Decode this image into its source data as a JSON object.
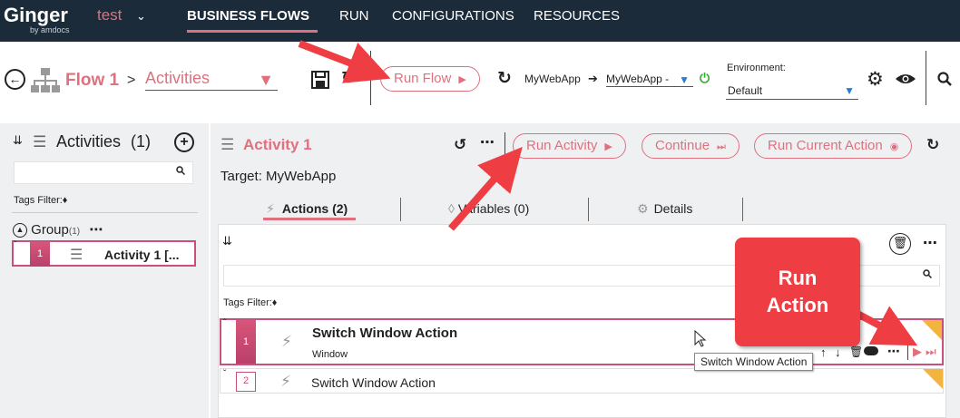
{
  "topbar": {
    "brand": "Ginger",
    "brand_sub": "by amdocs",
    "solution": "test",
    "nav": [
      "BUSINESS FLOWS",
      "RUN",
      "CONFIGURATIONS",
      "RESOURCES"
    ]
  },
  "flow_header": {
    "flow_name": "Flow 1",
    "separator": ">",
    "section_dropdown": "Activities",
    "run_flow_label": "Run Flow",
    "target_app": "MyWebApp",
    "target_agent": "MyWebApp -",
    "environment_label": "Environment:",
    "environment_value": "Default"
  },
  "left_panel": {
    "title": "Activities",
    "count": "(1)",
    "tags_filter_label": "Tags Filter:",
    "group_label": "Group",
    "group_count": "(1)",
    "activity": {
      "index": "1",
      "name": "Activity 1 [..."
    }
  },
  "main_panel": {
    "activity_title": "Activity 1",
    "run_activity_label": "Run Activity",
    "continue_label": "Continue",
    "run_current_action_label": "Run Current Action",
    "target_label": "Target: MyWebApp",
    "tabs": [
      "Actions (2)",
      "Variables (0)",
      "Details"
    ],
    "tags_filter_label": "Tags Filter:",
    "actions": [
      {
        "index": "1",
        "name": "Switch Window Action",
        "sub": "Window"
      },
      {
        "index": "2",
        "name": "Switch Window Action",
        "sub": ""
      }
    ],
    "tooltip": "Switch Window Action"
  },
  "callout": {
    "line1": "Run",
    "line2": "Action"
  },
  "colors": {
    "accent": "#e0707e",
    "nav_bg": "#1c2b3a",
    "callout": "#ef3d44",
    "badge": "#c94f7c",
    "corner": "#f3b43f"
  }
}
